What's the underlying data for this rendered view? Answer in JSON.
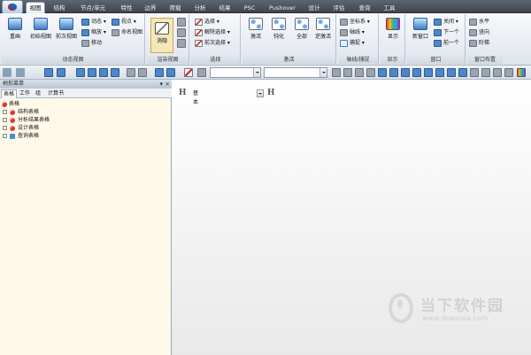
{
  "ribbon_tabs": [
    "视图",
    "结构",
    "节点/单元",
    "特性",
    "边界",
    "荷载",
    "分析",
    "结果",
    "PSC",
    "Pushover",
    "设计",
    "评估",
    "查询",
    "工具"
  ],
  "active_tab": "视图",
  "groups": {
    "dynamic_view": {
      "label": "动态视图",
      "big": [
        "重画",
        "初始视图",
        "前次视图"
      ],
      "small": [
        "动态",
        "缩放",
        "移动",
        "视点",
        "命名视图"
      ]
    },
    "render_view": {
      "label": "渲染视图",
      "big": [
        "消隐"
      ]
    },
    "select": {
      "label": "选择",
      "small": [
        "选择",
        "解除选择",
        "前次选择"
      ]
    },
    "activate": {
      "label": "激活",
      "big": [
        "激活",
        "钝化",
        "全部",
        "逆激活"
      ]
    },
    "axis_grid": {
      "label": "轴线/捕捉",
      "small": [
        "坐标系",
        "轴线",
        "捕捉"
      ]
    },
    "display": {
      "label": "显示",
      "big": [
        "显示"
      ]
    },
    "window": {
      "label": "窗口",
      "big": [
        "新窗口"
      ],
      "small": [
        "关闭",
        "下一个",
        "前一个"
      ]
    },
    "window_layout": {
      "label": "窗口布置",
      "small": [
        "水平",
        "竖向",
        "阶梯"
      ]
    }
  },
  "panel": {
    "title": "树形菜单",
    "close": "×",
    "pin": "▾",
    "tabs": [
      "表格",
      "工作",
      "组",
      "计算书"
    ],
    "tree": [
      "表格",
      "结构表格",
      "分析结果表格",
      "设计表格",
      "查询表格"
    ]
  },
  "view": {
    "label": "基本"
  },
  "watermark": {
    "title": "当下软件园",
    "url": "www.downxia.com"
  }
}
